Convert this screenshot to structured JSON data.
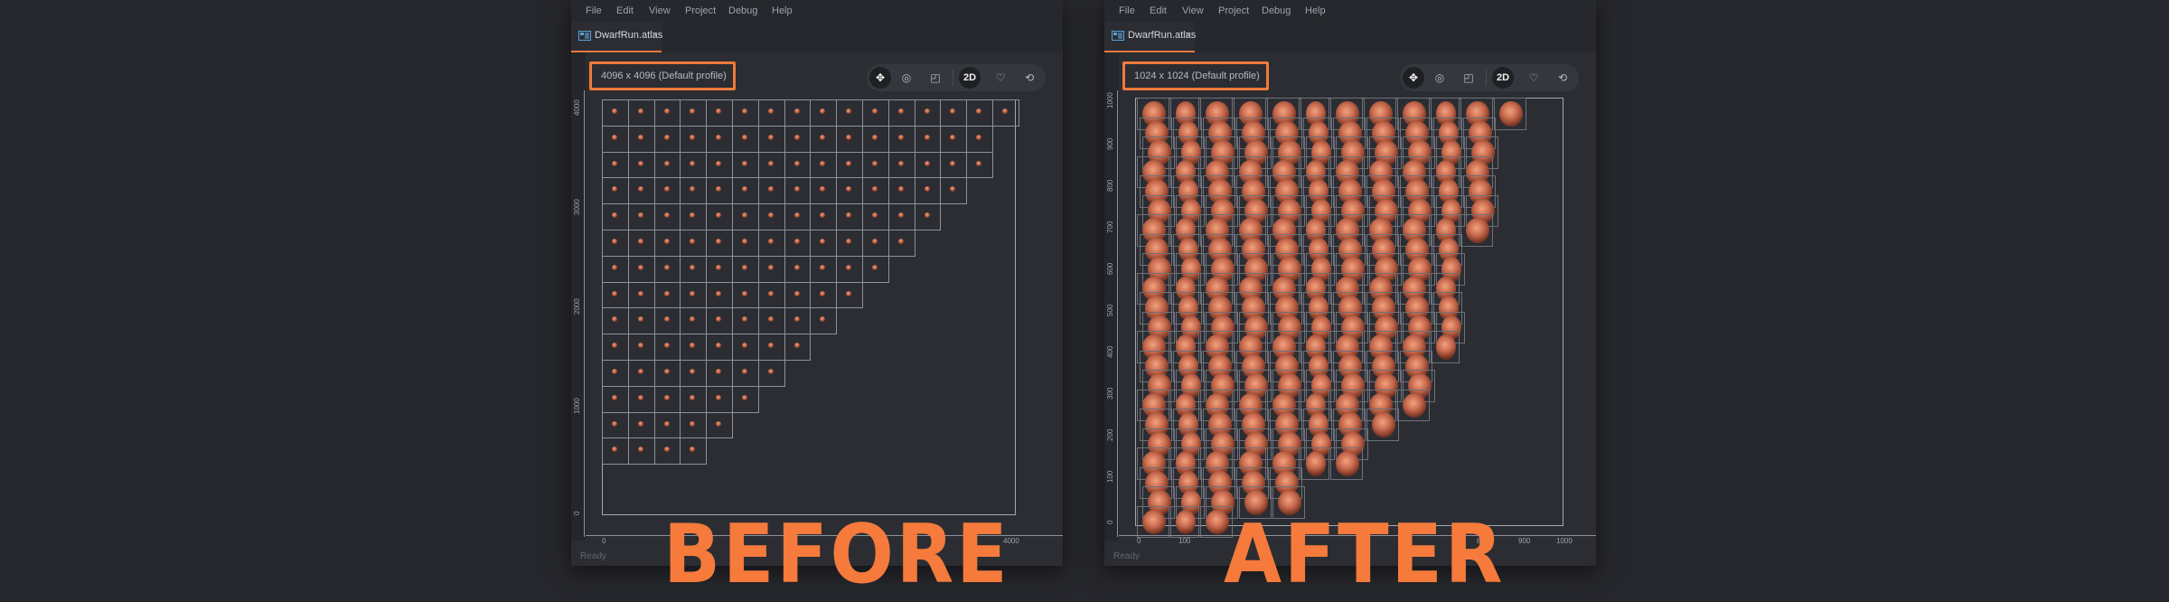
{
  "left_panel": {
    "menu": [
      "File",
      "Edit",
      "View",
      "Project",
      "Debug",
      "Help"
    ],
    "tab": {
      "label": "DwarfRun.atlas",
      "close": "×"
    },
    "profile_label": "4096 x 4096 (Default profile)",
    "toolbar": {
      "icons": [
        "move-icon",
        "rotate-icon",
        "scale-icon",
        "2d-mode",
        "visibility-icon",
        "camera-icon"
      ],
      "mode_label": "2D"
    },
    "ruler_x_ticks": [
      "0",
      "4000"
    ],
    "ruler_y_ticks": [
      "4000",
      "3000",
      "2000",
      "1000",
      "0"
    ],
    "status": "Ready",
    "grid_rows": [
      16,
      15,
      15,
      14,
      13,
      12,
      11,
      10,
      9,
      8,
      7,
      6,
      5,
      4
    ]
  },
  "right_panel": {
    "menu": [
      "File",
      "Edit",
      "View",
      "Project",
      "Debug",
      "Help"
    ],
    "tab": {
      "label": "DwarfRun.atlas",
      "close": "×"
    },
    "profile_label": "1024 x 1024 (Default profile)",
    "toolbar": {
      "icons": [
        "move-icon",
        "rotate-icon",
        "scale-icon",
        "2d-mode",
        "visibility-icon",
        "camera-icon"
      ],
      "mode_label": "2D"
    },
    "ruler_x_ticks": [
      "0",
      "100",
      "800",
      "900",
      "1000"
    ],
    "ruler_y_ticks": [
      "1000",
      "900",
      "800",
      "700",
      "600",
      "500",
      "400",
      "300",
      "200",
      "100",
      "0"
    ],
    "status": "Ready",
    "row_counts": [
      12,
      11,
      11,
      11,
      11,
      11,
      11,
      10,
      10,
      10,
      10,
      10,
      10,
      9,
      9,
      9,
      8,
      7,
      7,
      5,
      5,
      3
    ]
  },
  "captions": {
    "before": "BEFORE",
    "after": "AFTER"
  },
  "colors": {
    "accent": "#f07a3a",
    "background": "#26272c",
    "panel": "#2b2d33"
  }
}
